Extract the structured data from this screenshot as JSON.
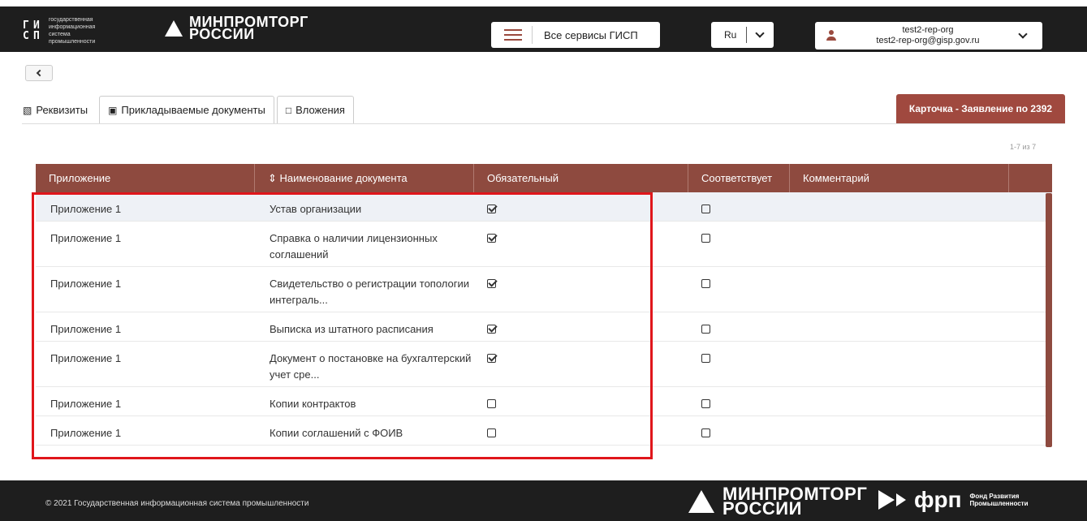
{
  "header": {
    "gisp_logo_text": "государственная информационная система промышленности",
    "ministry": "МИНПРОМТОРГ РОССИИ",
    "services_label": "Все сервисы ГИСП",
    "lang": "Ru",
    "user_name": "test2-rep-org",
    "user_email": "test2-rep-org@gisp.gov.ru"
  },
  "tabs": [
    {
      "label": "Реквизиты",
      "icon": "book-icon"
    },
    {
      "label": "Прикладываемые документы",
      "icon": "inbox-icon"
    },
    {
      "label": "Вложения",
      "icon": "file-icon"
    }
  ],
  "card_label": "Карточка - Заявление по 2392",
  "pager": "1-7 из 7",
  "table": {
    "columns": [
      "Приложение",
      "⇕ Наименование документа",
      "Обязательный",
      "Соответствует",
      "Комментарий",
      ""
    ],
    "rows": [
      {
        "appendix": "Приложение 1",
        "name": "Устав организации",
        "required": true,
        "matches": false,
        "comment": ""
      },
      {
        "appendix": "Приложение 1",
        "name": "Справка о наличии лицензионных соглашений",
        "required": true,
        "matches": false,
        "comment": ""
      },
      {
        "appendix": "Приложение 1",
        "name": "Свидетельство о регистрации топологии интеграль...",
        "required": true,
        "matches": false,
        "comment": ""
      },
      {
        "appendix": "Приложение 1",
        "name": "Выписка из штатного расписания",
        "required": true,
        "matches": false,
        "comment": ""
      },
      {
        "appendix": "Приложение 1",
        "name": "Документ о постановке на бухгалтерский учет сре...",
        "required": true,
        "matches": false,
        "comment": ""
      },
      {
        "appendix": "Приложение 1",
        "name": "Копии контрактов",
        "required": false,
        "matches": false,
        "comment": ""
      },
      {
        "appendix": "Приложение 1",
        "name": "Копии соглашений с ФОИВ",
        "required": false,
        "matches": false,
        "comment": ""
      }
    ]
  },
  "footer": {
    "copyright": "© 2021 Государственная информационная система промышленности",
    "ministry": "МИНПРОМТОРГ РОССИИ",
    "frp_name": "фрп",
    "frp_sub": "Фонд Развития Промышленности"
  },
  "colors": {
    "brand": "#8e4a3f",
    "dark": "#1e1e1e",
    "highlight": "#e0161b"
  }
}
